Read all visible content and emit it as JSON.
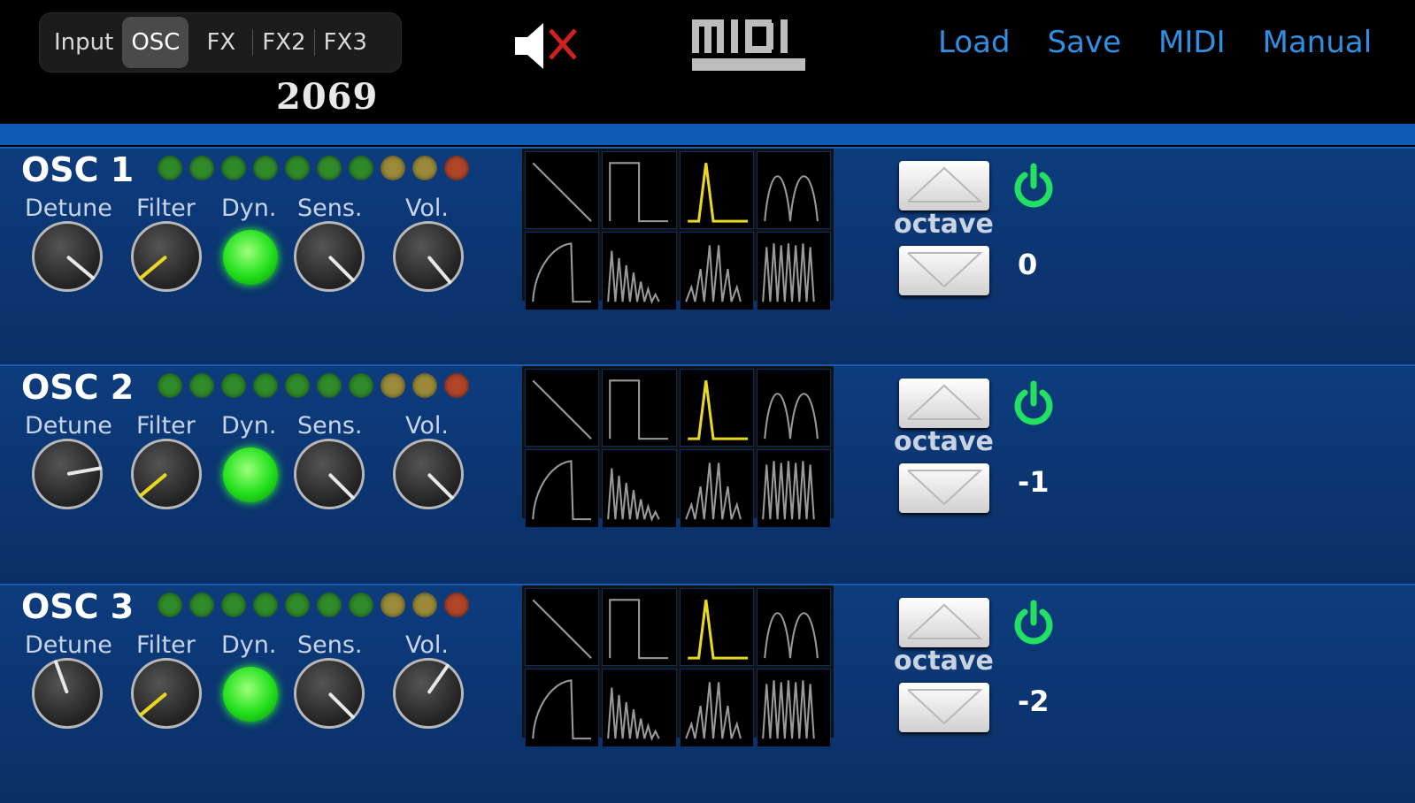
{
  "tabs": [
    {
      "label": "Input",
      "active": false
    },
    {
      "label": "OSC",
      "active": true
    },
    {
      "label": "FX",
      "active": false
    },
    {
      "label": "FX2",
      "active": false
    },
    {
      "label": "FX3",
      "active": false
    }
  ],
  "brand": "2069",
  "midi_logo": "MIDI",
  "mute_icon": "speaker-muted-icon",
  "nav": [
    "Load",
    "Save",
    "MIDI",
    "Manual"
  ],
  "knob_labels": [
    "Detune",
    "Filter",
    "Dyn.",
    "Sens.",
    "Vol."
  ],
  "octave_label": "octave",
  "colors": {
    "accent_link": "#2f8fe0",
    "led_green": "#2f8a2a",
    "led_yellow": "#9a8a3a",
    "led_red": "#b0452a",
    "power": "#22e060",
    "wave_active": "#e8d820"
  },
  "oscillators": [
    {
      "title": "OSC 1",
      "octave": "0",
      "active_wave": 2
    },
    {
      "title": "OSC 2",
      "octave": "-1",
      "active_wave": 2
    },
    {
      "title": "OSC 3",
      "octave": "-2",
      "active_wave": 2
    }
  ],
  "waveforms": [
    "saw-wave-icon",
    "square-wave-icon",
    "pulse-wave-icon",
    "arch-wave-icon",
    "ramp-wave-icon",
    "decay-wave-icon",
    "bell-wave-icon",
    "dense-wave-icon"
  ]
}
